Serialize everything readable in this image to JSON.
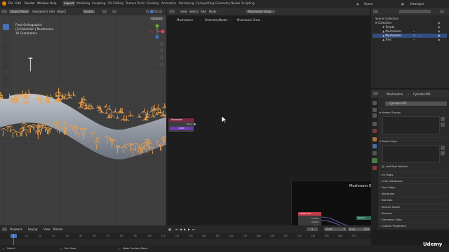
{
  "menu": [
    "File",
    "Edit",
    "Render",
    "Window",
    "Help"
  ],
  "workspaces": [
    "Layout",
    "Modeling",
    "Sculpting",
    "UV Editing",
    "Texture Paint",
    "Shading",
    "Animation",
    "Rendering",
    "Compositing",
    "Geometry Nodes",
    "Scripting"
  ],
  "active_workspace": "Layout",
  "scene": {
    "label": "Scene",
    "view_layer": "ViewLayer"
  },
  "viewport": {
    "mode": "Object Mode",
    "menus": [
      "View",
      "Select",
      "Add",
      "Object"
    ],
    "transform": "Global",
    "options": "Options",
    "overlay_text": [
      "Front Orthographic",
      "(1) Collection | Mushrooms",
      "10 Centimeters"
    ],
    "gizmo": {
      "x": "X",
      "y": "Y",
      "z": "Z"
    }
  },
  "node_editor": {
    "menus": [
      "View",
      "Select",
      "Add",
      "Node"
    ],
    "tree_name": "Mushroom Grow",
    "breadcrumb": [
      "Mushrooms",
      "GeometryNodes",
      "Mushroom Grow"
    ],
    "node": {
      "title": "Parameter",
      "output": "Value",
      "value": "2.000"
    },
    "preview": {
      "title": "Mushroom G",
      "node_title": "Object Info",
      "rows": [
        "Location",
        "Rotation",
        "Scale"
      ],
      "right_node": "Realize"
    }
  },
  "outliner": {
    "title": "Scene Collection",
    "items": [
      {
        "label": "Collection",
        "level": 1
      },
      {
        "label": "Empty",
        "level": 2
      },
      {
        "label": "Mushrooms",
        "level": 2
      },
      {
        "label": "Mushrooms",
        "level": 2,
        "selected": true
      },
      {
        "label": "Tree",
        "level": 2
      }
    ]
  },
  "properties": {
    "breadcrumb": [
      "Mushrooms",
      "Cylinder.001"
    ],
    "mesh_name": "Cylinder.001",
    "panels": [
      "Vertex Groups",
      "Shape Keys",
      "UV Maps",
      "Color Attributes",
      "Face Maps",
      "Attributes",
      "Normals",
      "Texture Space",
      "Remesh",
      "Geometry Data",
      "Custom Properties"
    ],
    "add_rest_position": "Add Rest Position"
  },
  "timeline": {
    "menus": [
      "Playback",
      "Keying",
      "View",
      "Marker"
    ],
    "current_frame": "1",
    "start_label": "Start",
    "start": "1",
    "end_label": "End",
    "end": "250",
    "ticks": [
      "0",
      "10",
      "20",
      "30",
      "40",
      "50",
      "60",
      "70",
      "80",
      "90",
      "100",
      "110",
      "120",
      "130",
      "140",
      "150",
      "160",
      "170",
      "180",
      "190",
      "200",
      "210",
      "220",
      "230",
      "240",
      "250"
    ]
  },
  "statusbar": {
    "select": "Select",
    "pan_view": "Pan View",
    "node_context": "Node Context Menu"
  },
  "watermark": "Udemy",
  "colors": {
    "accent": "#4772b3",
    "node_header": "#7a2846",
    "mushroom": "#e9a04e",
    "value_bar": "#6f3bb3"
  }
}
